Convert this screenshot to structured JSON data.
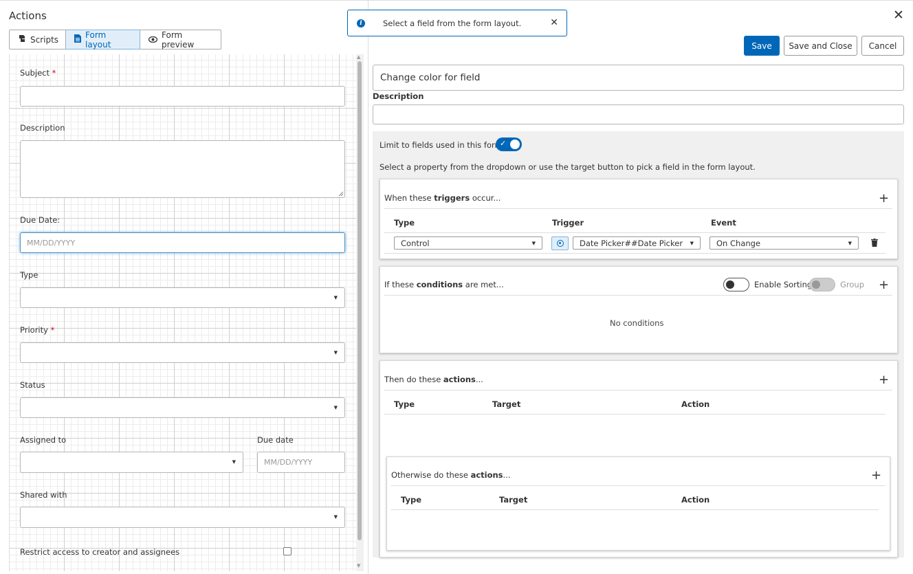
{
  "app": {
    "title": "Actions"
  },
  "tabs": [
    {
      "label": "Scripts",
      "icon": "scripts-icon"
    },
    {
      "label": "Form layout",
      "icon": "document-icon"
    },
    {
      "label": "Form preview",
      "icon": "eye-icon"
    }
  ],
  "form": {
    "subject_label": "Subject",
    "required_mark": "*",
    "description_label": "Description",
    "due_date_label": "Due Date:",
    "due_date_placeholder": "MM/DD/YYYY",
    "type_label": "Type",
    "priority_label": "Priority",
    "status_label": "Status",
    "assigned_to_label": "Assigned to",
    "due_date2_label": "Due date",
    "due_date2_placeholder": "MM/DD/YYYY",
    "shared_with_label": "Shared with",
    "restrict_label": "Restrict access to creator and assignees"
  },
  "toast": {
    "message": "Select a field from the form layout."
  },
  "toolbar": {
    "save": "Save",
    "save_close": "Save and Close",
    "cancel": "Cancel"
  },
  "rule": {
    "name_value": "Change color for field",
    "description_label": "Description",
    "limit_label": "Limit to fields used in this form",
    "limit_enabled": true,
    "hint": "Select a property from the dropdown or use the target button to pick a field in the form layout."
  },
  "triggers": {
    "title_pre": "When these ",
    "title_bold": "triggers",
    "title_post": " occur...",
    "columns": [
      "Type",
      "Trigger",
      "Event"
    ],
    "row": {
      "type": "Control",
      "trigger": "Date Picker##Date Picker",
      "event": "On Change"
    }
  },
  "conditions": {
    "title_pre": "If these ",
    "title_bold": "conditions",
    "title_post": " are met...",
    "enable_sorting_label": "Enable Sorting",
    "group_label": "Group",
    "empty": "No conditions"
  },
  "actions": {
    "title_pre": "Then do these ",
    "title_bold": "actions",
    "title_post": "...",
    "columns": [
      "Type",
      "Target",
      "Action"
    ]
  },
  "otherwise": {
    "title_pre": "Otherwise do these ",
    "title_bold": "actions",
    "title_post": "...",
    "columns": [
      "Type",
      "Target",
      "Action"
    ]
  },
  "colors": {
    "accent": "#0067b8",
    "required": "#d0021b"
  }
}
